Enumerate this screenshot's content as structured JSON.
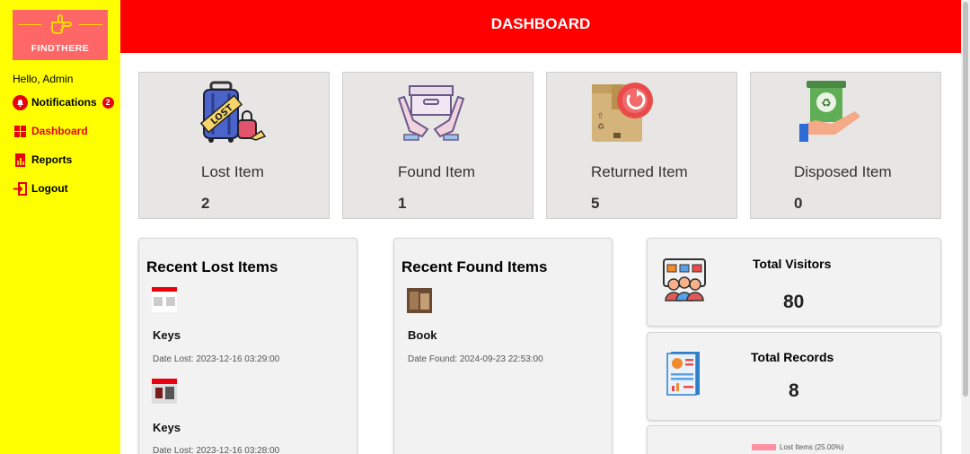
{
  "sidebar": {
    "brand": "FINDTHERE",
    "greeting": "Hello, Admin",
    "items": [
      {
        "label": "Notifications",
        "badge": "2",
        "icon": "bell-icon"
      },
      {
        "label": "Dashboard",
        "icon": "grid-icon"
      },
      {
        "label": "Reports",
        "icon": "report-icon"
      },
      {
        "label": "Logout",
        "icon": "logout-icon"
      }
    ]
  },
  "header": {
    "title": "DASHBOARD"
  },
  "stats": [
    {
      "label": "Lost Item",
      "value": "2",
      "icon": "lost-luggage-icon"
    },
    {
      "label": "Found Item",
      "value": "1",
      "icon": "found-box-icon"
    },
    {
      "label": "Returned Item",
      "value": "5",
      "icon": "returned-box-icon"
    },
    {
      "label": "Disposed Item",
      "value": "0",
      "icon": "recycle-bin-icon"
    }
  ],
  "recent_lost": {
    "title": "Recent Lost Items",
    "items": [
      {
        "name": "Keys",
        "date": "Date Lost: 2023-12-16 03:29:00"
      },
      {
        "name": "Keys",
        "date": "Date Lost: 2023-12-16 03:28:00"
      }
    ]
  },
  "recent_found": {
    "title": "Recent Found Items",
    "items": [
      {
        "name": "Book",
        "date": "Date Found: 2024-09-23 22:53:00"
      }
    ]
  },
  "visitors": {
    "title": "Total Visitors",
    "value": "80",
    "icon": "visitors-icon"
  },
  "records": {
    "title": "Total Records",
    "value": "8",
    "icon": "records-icon"
  },
  "pie_legend": {
    "label": "Lost Items (25.00%)",
    "color": "#ff8fa3"
  },
  "colors": {
    "sidebar": "#ffff00",
    "header": "#ff0000",
    "accent": "#e8000f"
  }
}
